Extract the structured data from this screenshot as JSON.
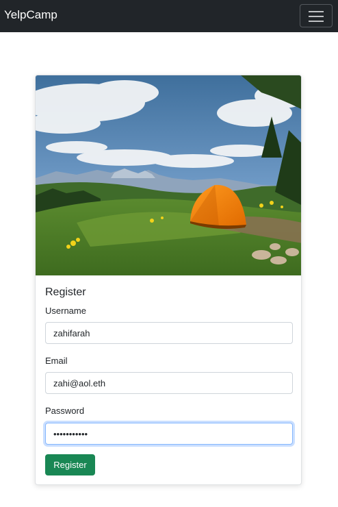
{
  "navbar": {
    "brand": "YelpCamp",
    "toggler_icon": "hamburger-menu-icon"
  },
  "card": {
    "image": "camping-tent-mountain-meadow-photo",
    "title": "Register",
    "fields": {
      "username": {
        "label": "Username",
        "value": "zahifarah"
      },
      "email": {
        "label": "Email",
        "value": "zahi@aol.eth"
      },
      "password": {
        "label": "Password",
        "value": "•••••••••••"
      }
    },
    "submit_label": "Register"
  },
  "colors": {
    "navbar_bg": "#212529",
    "button_bg": "#198754",
    "focus_ring": "#86b7fe"
  }
}
